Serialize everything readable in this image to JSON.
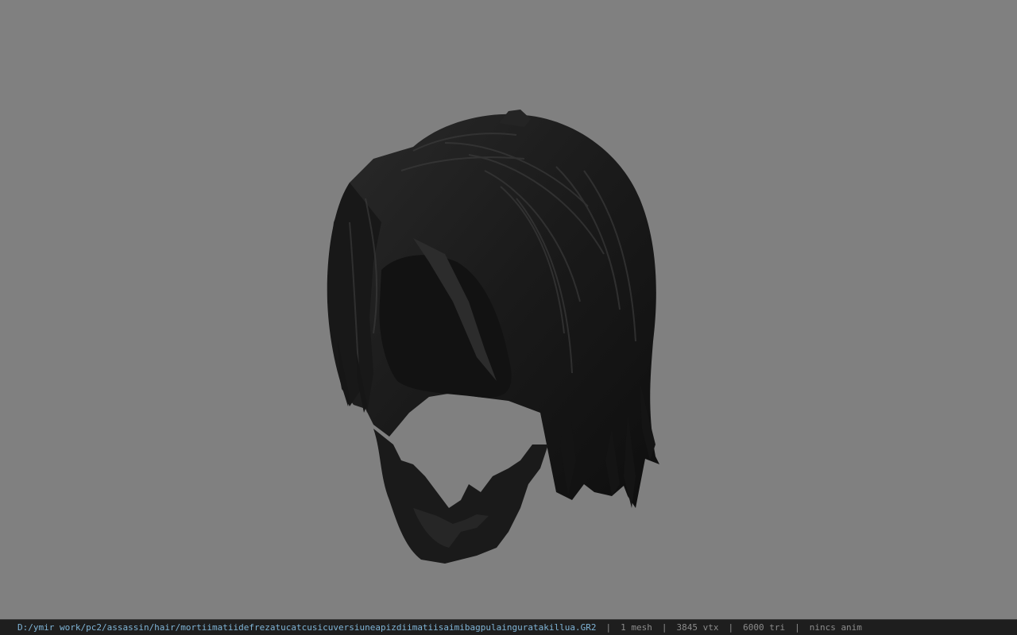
{
  "viewport": {
    "background": "#808080",
    "model_name": "hair-model"
  },
  "statusbar": {
    "path": "D:/ymir work/pc2/assassin/hair/mortiimatiidefrezatucatcusicuversiuneapizdiimatiisaimibagpulainguratakillua.GR2",
    "separator": "|",
    "mesh": "1 mesh",
    "vertices": "3845 vtx",
    "triangles": "6000 tri",
    "animation": "nincs anim"
  }
}
